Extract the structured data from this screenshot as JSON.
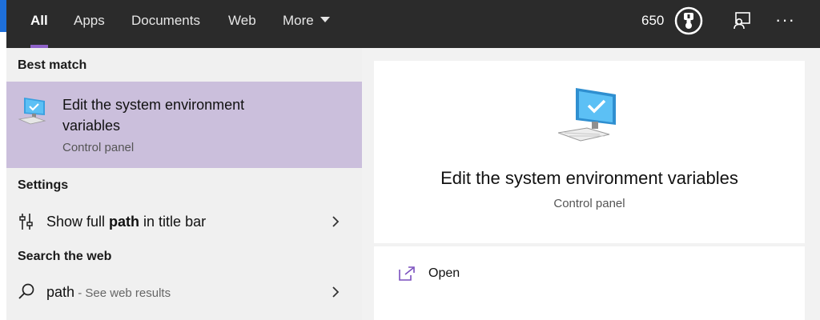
{
  "tabs": [
    {
      "label": "All",
      "active": true
    },
    {
      "label": "Apps"
    },
    {
      "label": "Documents"
    },
    {
      "label": "Web"
    },
    {
      "label": "More"
    }
  ],
  "header": {
    "points": "650",
    "icons": {
      "rewards": "rewards-medal-icon",
      "feedback": "feedback-icon",
      "more": "more-options-icon"
    },
    "more_options_label": "···"
  },
  "colors": {
    "header_bg": "#2b2b2b",
    "accent": "#8e62c8",
    "selection_bg": "#cbbfdc",
    "panel_bg": "#f0f0f0"
  },
  "results": {
    "best_match_heading": "Best match",
    "best_match": {
      "title": "Edit the system environment variables",
      "subtitle": "Control panel",
      "icon": "computer-checkmark-icon"
    },
    "settings_heading": "Settings",
    "settings_item": {
      "pre": "Show full ",
      "bold": "path",
      "post": " in title bar",
      "icon": "settings-sliders-icon"
    },
    "web_heading": "Search the web",
    "web_item": {
      "query": "path",
      "hint": " - See web results",
      "icon": "search-icon"
    }
  },
  "preview": {
    "title": "Edit the system environment variables",
    "subtitle": "Control panel",
    "icon": "computer-checkmark-icon",
    "actions": [
      {
        "label": "Open",
        "icon": "open-external-icon"
      }
    ]
  }
}
